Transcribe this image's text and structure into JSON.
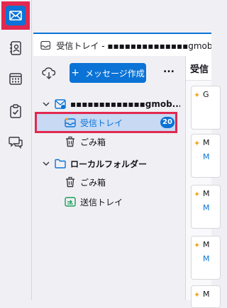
{
  "tab": {
    "title": "受信トレイ - ▪▪▪▪▪▪▪▪▪▪▪▪▪▪gmobb.jp"
  },
  "toolbar": {
    "compose_label": "メッセージ作成",
    "compose_plus": "+",
    "more_label": "..."
  },
  "folders": {
    "account_name": "▪▪▪▪▪▪▪▪▪▪▪▪▪gmob...",
    "inbox_label": "受信トレイ",
    "inbox_unread": "20",
    "trash_label": "ごみ箱",
    "local_label": "ローカルフォルダー",
    "local_trash_label": "ごみ箱",
    "outbox_label": "送信トレイ"
  },
  "thread": {
    "header": "受信",
    "messages": [
      {
        "from": "G",
        "sub": ""
      },
      {
        "from": "M",
        "sub": "M"
      },
      {
        "from": "M",
        "sub": "M"
      },
      {
        "from": "M",
        "sub": "M"
      },
      {
        "from": "M",
        "sub": ""
      }
    ]
  },
  "colors": {
    "accent": "#0b73d6",
    "highlight": "#e22850",
    "selection": "#c7d9f3"
  }
}
